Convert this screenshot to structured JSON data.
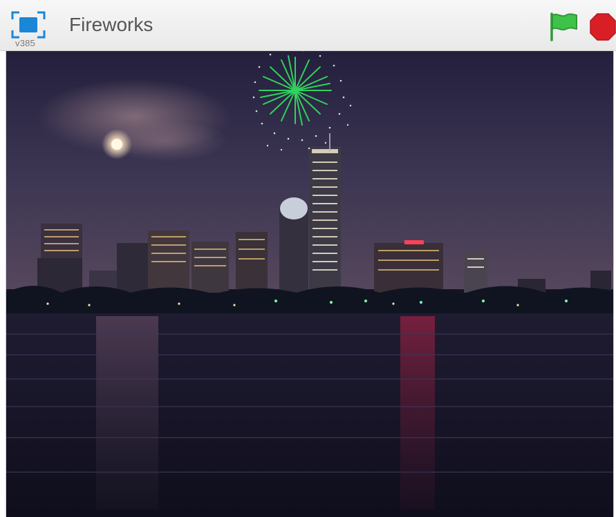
{
  "header": {
    "title": "Fireworks",
    "version": "v385"
  },
  "controls": {
    "fullscreen_icon": "fullscreen-icon",
    "green_flag_icon": "green-flag-icon",
    "stop_icon": "stop-sign-icon"
  },
  "colors": {
    "accent_blue": "#1a86d6",
    "flag_green": "#3fc24a",
    "stop_red": "#d81f26",
    "firework_green": "#2fd35d"
  }
}
